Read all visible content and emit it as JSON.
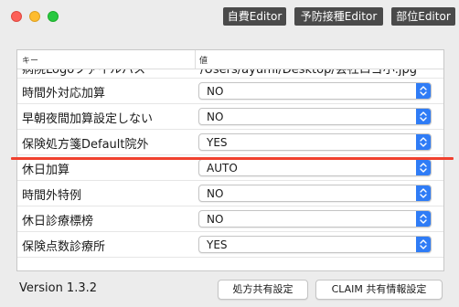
{
  "toolbar": {
    "buttons": [
      {
        "label": "自費Editor"
      },
      {
        "label": "予防接種Editor"
      },
      {
        "label": "部位Editor"
      }
    ]
  },
  "table": {
    "columns": [
      "キー",
      "値"
    ],
    "clipped_row": {
      "key": "病院Logoファイルパス",
      "value": "/Users/ayumi/Desktop/会社ロゴ小.jpg"
    },
    "rows": [
      {
        "key": "時間外対応加算",
        "value": "NO"
      },
      {
        "key": "早朝夜間加算設定しない",
        "value": "NO"
      },
      {
        "key": "保険処方箋Default院外",
        "value": "YES"
      },
      {
        "key": "休日加算",
        "value": "AUTO"
      },
      {
        "key": "時間外特例",
        "value": "NO"
      },
      {
        "key": "休日診療標榜",
        "value": "NO"
      },
      {
        "key": "保険点数診療所",
        "value": "YES"
      }
    ]
  },
  "highlight_color": "#f0412f",
  "footer": {
    "version": "Version 1.3.2",
    "buttons": [
      {
        "label": "処方共有設定"
      },
      {
        "label": "CLAIM 共有情報設定"
      }
    ]
  }
}
